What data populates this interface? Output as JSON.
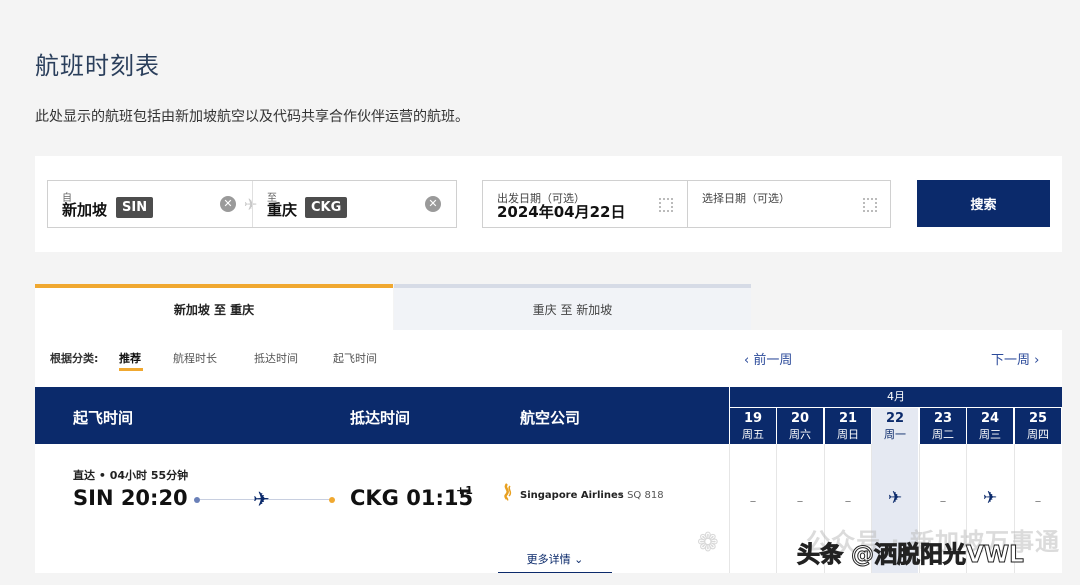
{
  "page": {
    "title": "航班时刻表",
    "description": "此处显示的航班包括由新加坡航空以及代码共享合作伙伴运营的航班。"
  },
  "search": {
    "from_label": "自",
    "from_city": "新加坡",
    "from_code": "SIN",
    "to_label": "至",
    "to_city": "重庆",
    "to_code": "CKG",
    "depart_label": "出发日期（可选）",
    "depart_value": "2024年04月22日",
    "return_label": "选择日期（可选）",
    "search_button": "搜索"
  },
  "tabs": [
    {
      "label": "新加坡 至 重庆",
      "active": true
    },
    {
      "label": "重庆 至 新加坡",
      "active": false
    }
  ],
  "sort": {
    "label": "根据分类:",
    "options": [
      "推荐",
      "航程时长",
      "抵达时间",
      "起飞时间"
    ],
    "active_index": 0
  },
  "week_nav": {
    "prev": "‹ 前一周",
    "next": "下一周 ›"
  },
  "table": {
    "headers": [
      "起飞时间",
      "抵达时间",
      "航空公司"
    ],
    "month": "4月",
    "days": [
      {
        "num": "19",
        "wd": "周五"
      },
      {
        "num": "20",
        "wd": "周六"
      },
      {
        "num": "21",
        "wd": "周日"
      },
      {
        "num": "22",
        "wd": "周一"
      },
      {
        "num": "23",
        "wd": "周二"
      },
      {
        "num": "24",
        "wd": "周三"
      },
      {
        "num": "25",
        "wd": "周四"
      }
    ],
    "selected_day_index": 3
  },
  "flight": {
    "meta": "直达 • 04小时 55分钟",
    "departure": "SIN 20:20",
    "arrival": "CKG 01:15",
    "plus_day": "+1",
    "airline": "Singapore Airlines",
    "flight_no": "• SQ 818",
    "more_details": "更多详情 ⌄",
    "day_marks": [
      "–",
      "–",
      "–",
      "✈",
      "–",
      "✈",
      "–"
    ]
  },
  "watermark": {
    "text1": "公众号 · 新加坡万事通",
    "text2": "头条 @洒脱阳光VWL"
  },
  "colors": {
    "primary": "#0b2a6b",
    "accent": "#f0a830"
  }
}
